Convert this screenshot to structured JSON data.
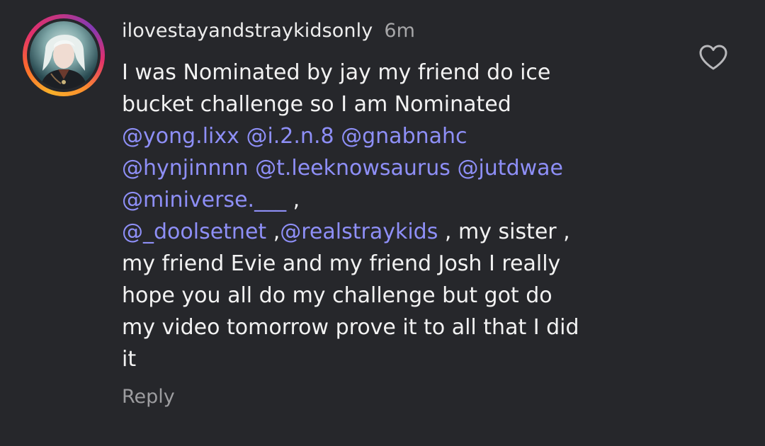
{
  "comment": {
    "username": "ilovestayandstraykidsonly",
    "time": "6m",
    "lines": [
      [
        {
          "t": "I was  Nominated by jay my friend do ice",
          "m": false
        }
      ],
      [
        {
          "t": "bucket challenge so I am  Nominated",
          "m": false
        }
      ],
      [
        {
          "t": "@yong.lixx",
          "m": true
        },
        {
          "t": "  ",
          "m": false
        },
        {
          "t": "@i.2.n.8",
          "m": true
        },
        {
          "t": " ",
          "m": false
        },
        {
          "t": "@gnabnahc",
          "m": true
        }
      ],
      [
        {
          "t": "@hynjinnnn",
          "m": true
        },
        {
          "t": "  ",
          "m": false
        },
        {
          "t": "@t.leeknowsaurus",
          "m": true
        },
        {
          "t": " ",
          "m": false
        },
        {
          "t": "@jutdwae",
          "m": true
        }
      ],
      [
        {
          "t": "@miniverse.___",
          "m": true
        },
        {
          "t": " ,",
          "m": false
        }
      ],
      [
        {
          "t": "@_doolsetnet",
          "m": true
        },
        {
          "t": " ,",
          "m": false
        },
        {
          "t": "@realstraykids",
          "m": true
        },
        {
          "t": " , my sister ,",
          "m": false
        }
      ],
      [
        {
          "t": "my friend Evie and my friend Josh  I really",
          "m": false
        }
      ],
      [
        {
          "t": "hope you all do my challenge  but got do",
          "m": false
        }
      ],
      [
        {
          "t": "my video tomorrow prove it to all that I did",
          "m": false
        }
      ],
      [
        {
          "t": "it",
          "m": false
        }
      ]
    ],
    "reply_label": "Reply",
    "like_icon": "heart-outline-icon"
  },
  "colors": {
    "background": "#26272b",
    "mention": "#8e8ff7",
    "text": "#f2f2f2",
    "muted": "#9d9da0"
  }
}
